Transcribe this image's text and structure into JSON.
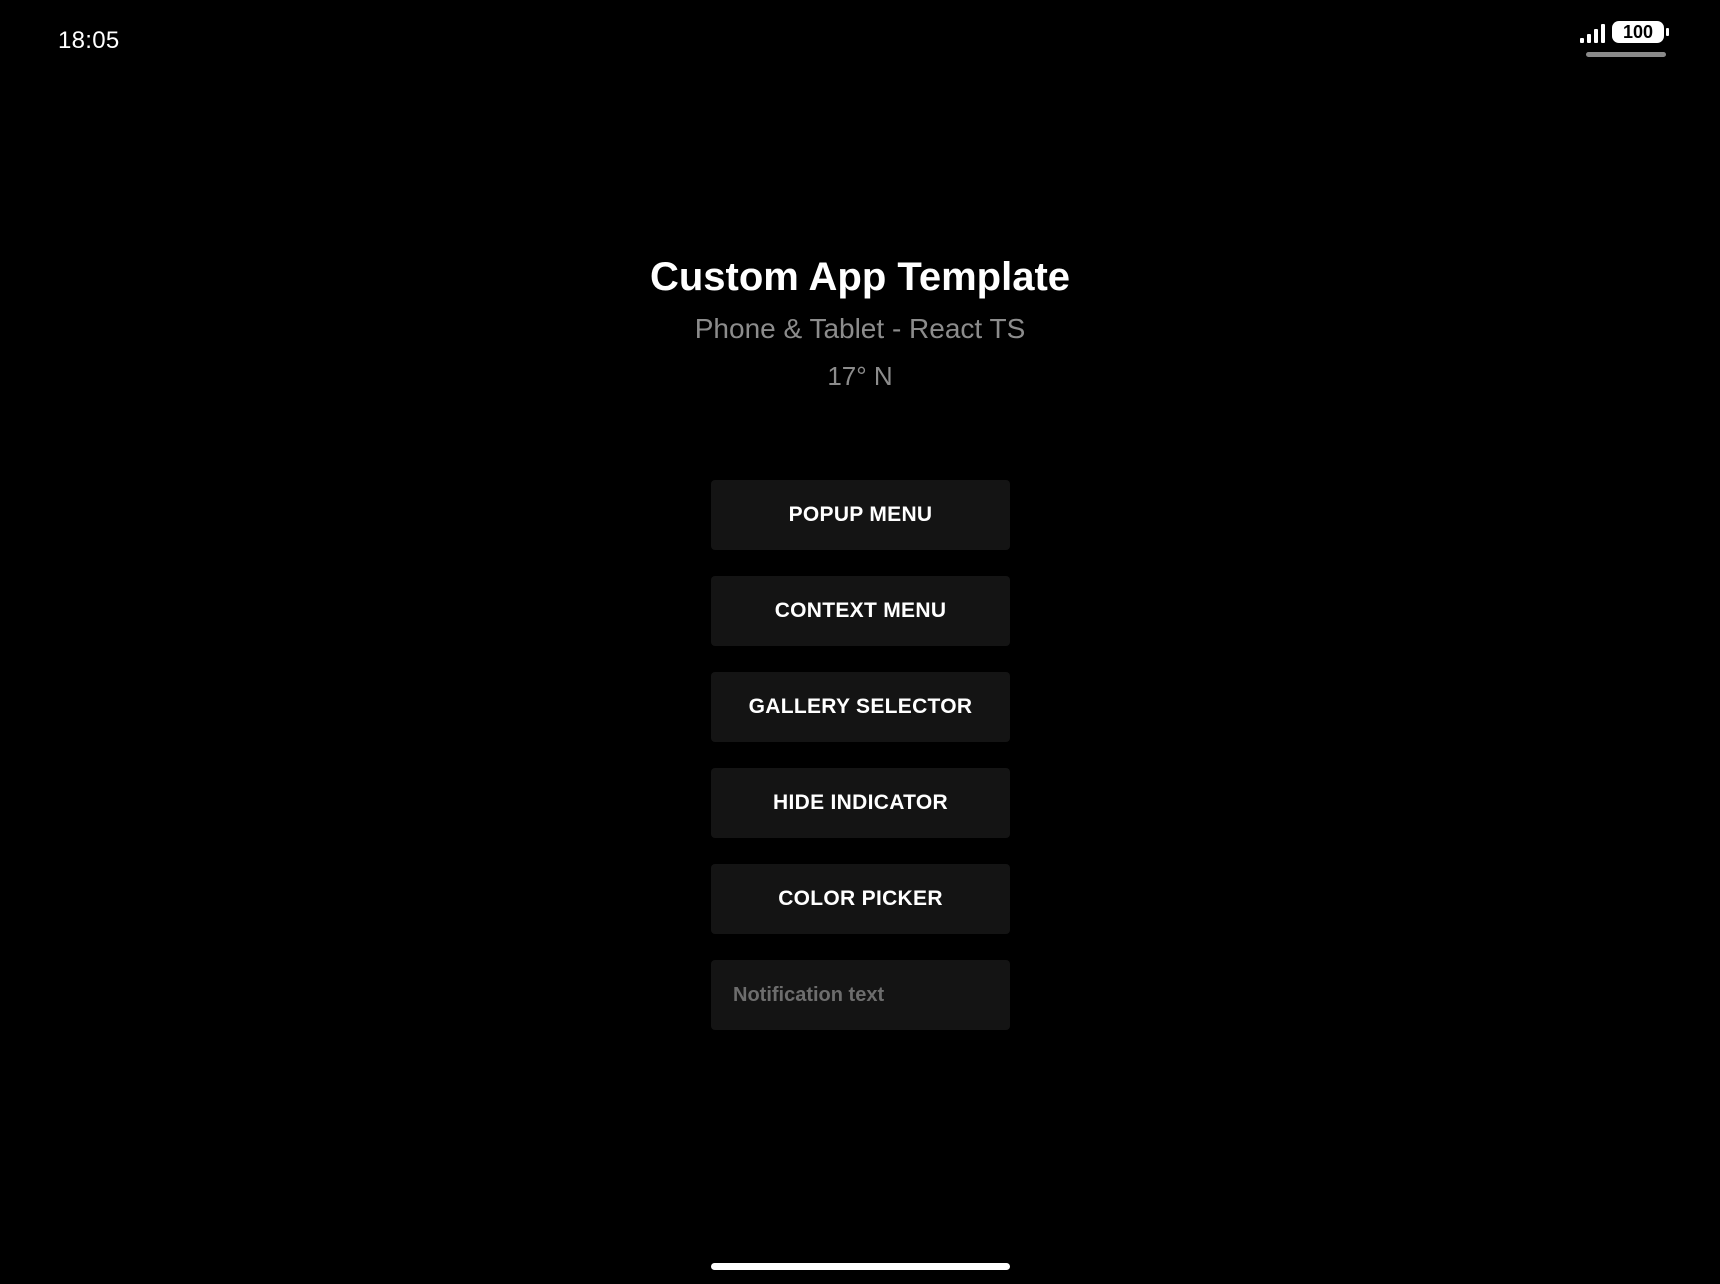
{
  "status_bar": {
    "time": "18:05",
    "battery_level": "100",
    "signal_icon": "cellular-signal-icon",
    "battery_icon": "battery-icon"
  },
  "header": {
    "title": "Custom App Template",
    "subtitle": "Phone & Tablet - React TS",
    "location": "17° N"
  },
  "menu": {
    "buttons": [
      {
        "label": "POPUP MENU"
      },
      {
        "label": "CONTEXT MENU"
      },
      {
        "label": "GALLERY SELECTOR"
      },
      {
        "label": "HIDE INDICATOR"
      },
      {
        "label": "COLOR PICKER"
      }
    ],
    "notification_input": {
      "placeholder": "Notification text",
      "value": ""
    }
  },
  "colors": {
    "background": "#000000",
    "button_background": "#141414",
    "text_primary": "#ffffff",
    "text_secondary": "#8c8c8c"
  }
}
